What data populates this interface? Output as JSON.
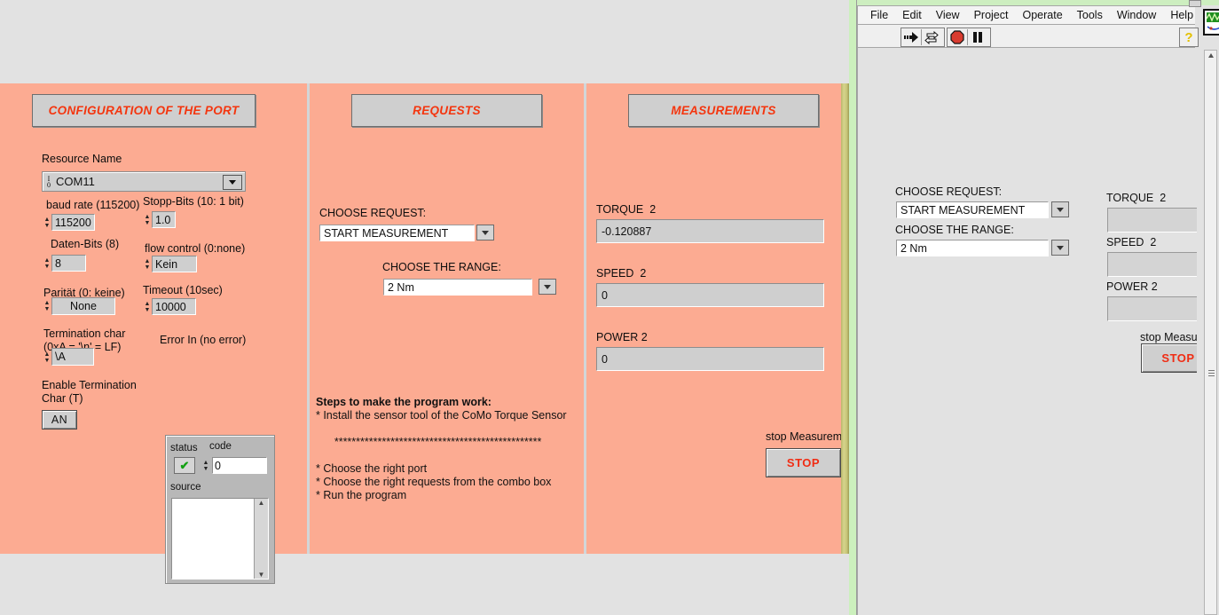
{
  "back_window": {
    "config_panel": {
      "title": "CONFIGURATION OF THE PORT",
      "resource_name_label": "Resource Name",
      "resource_name_value": "COM11",
      "resource_icon": "visa-io-icon",
      "fields": [
        {
          "label": "baud rate (115200)",
          "value": "115200"
        },
        {
          "label": "Stopp-Bits (10: 1 bit)",
          "value": "1.0"
        },
        {
          "label": "Daten-Bits (8)",
          "value": "8"
        },
        {
          "label": "flow control (0:none)",
          "value": "Kein"
        },
        {
          "label": "Parität (0: keine)",
          "value": "None"
        },
        {
          "label": "Timeout (10sec)",
          "value": "10000"
        },
        {
          "label": "Termination char\n(0xA = '\\n' = LF)",
          "value": "\\A"
        }
      ],
      "enable_term_label": "Enable Termination\nChar (T)",
      "enable_term_value": "AN",
      "error_in_label": "Error In (no error)",
      "error_status_label": "status",
      "error_code_label": "code",
      "error_code_value": "0",
      "error_source_label": "source",
      "error_status_ok_glyph": "✔"
    },
    "requests_panel": {
      "title": "REQUESTS",
      "choose_request_label": "CHOOSE REQUEST:",
      "choose_request_value": "START MEASUREMENT",
      "choose_range_label": "CHOOSE THE RANGE:",
      "choose_range_value": "2 Nm",
      "instructions_heading": "Steps to make the program work:",
      "instructions_line1": "* Install the sensor tool of the CoMo Torque Sensor",
      "instructions_divider": "************************************************",
      "instructions_line2": "* Choose the right port",
      "instructions_line3": "* Choose the right requests from the combo box",
      "instructions_line4": "* Run the program"
    },
    "measurements_panel": {
      "title": "MEASUREMENTS",
      "indicators": [
        {
          "label": "TORQUE  2",
          "value": "-0.120887"
        },
        {
          "label": "SPEED  2",
          "value": "0"
        },
        {
          "label": "POWER 2",
          "value": "0"
        }
      ],
      "stop_label": "stop Measureme",
      "stop_button": "STOP"
    }
  },
  "front_window": {
    "menu": [
      "File",
      "Edit",
      "View",
      "Project",
      "Operate",
      "Tools",
      "Window",
      "Help"
    ],
    "toolbar": {
      "run_icon": "run-arrow-icon",
      "run_continuous_icon": "run-continuously-icon",
      "abort_icon": "abort-stop-icon",
      "pause_icon": "pause-icon",
      "help_icon": "context-help-icon",
      "help_glyph": "?"
    },
    "vi_icon": "vi-waveform-icon",
    "choose_request_label": "CHOOSE REQUEST:",
    "choose_request_value": "START MEASUREMENT",
    "choose_range_label": "CHOOSE THE RANGE:",
    "choose_range_value": "2 Nm",
    "indicators": [
      {
        "label": "TORQUE  2",
        "value": ""
      },
      {
        "label": "SPEED  2",
        "value": ""
      },
      {
        "label": "POWER 2",
        "value": ""
      }
    ],
    "stop_label": "stop Measurem",
    "stop_button": "STOP"
  },
  "colors": {
    "panel_background": "#fcab92",
    "title_text": "#f4350e",
    "stop_text": "#f02c13",
    "window_background": "#e2e2e2",
    "control_face": "#cfcfcf",
    "green_strip": "#ccf0bd",
    "scroll_strip": "#c9c77a"
  }
}
